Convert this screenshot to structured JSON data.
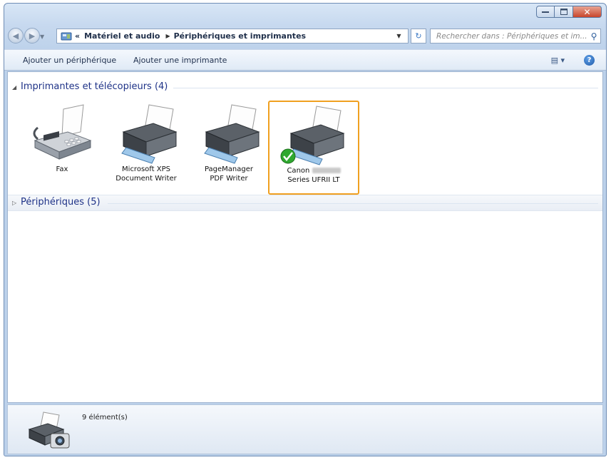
{
  "address": {
    "crumbs": [
      "Matériel et audio",
      "Périphériques et imprimantes"
    ],
    "prefix": "«"
  },
  "search": {
    "placeholder": "Rechercher dans : Périphériques et im..."
  },
  "toolbar": {
    "add_device": "Ajouter un périphérique",
    "add_printer": "Ajouter une imprimante"
  },
  "groups": {
    "printers": "Imprimantes et télécopieurs (4)",
    "devices": "Périphériques (5)"
  },
  "devices": [
    {
      "line1": "Fax",
      "line2": ""
    },
    {
      "line1": "Microsoft XPS",
      "line2": "Document Writer"
    },
    {
      "line1": "PageManager",
      "line2": "PDF Writer"
    },
    {
      "line1": "Canon",
      "line2": "Series UFRII LT"
    }
  ],
  "status": {
    "count": "9 élément(s)"
  },
  "colors": {
    "selection": "#f0a020",
    "link_blue": "#1e3287",
    "default_check": "#2fa82f"
  }
}
